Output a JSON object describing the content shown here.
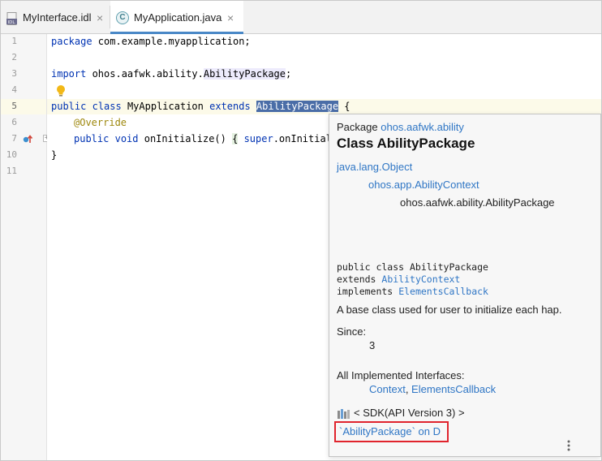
{
  "tabs": [
    {
      "label": "MyInterface.idl",
      "icon": "idl-file-icon",
      "active": false
    },
    {
      "label": "MyApplication.java",
      "icon": "java-class-icon",
      "active": true
    }
  ],
  "line_numbers": [
    "1",
    "2",
    "3",
    "4",
    "5",
    "6",
    "7",
    "10",
    "11"
  ],
  "code": {
    "line1_kw": "package",
    "line1_rest": " com.example.myapplication;",
    "line3_kw": "import",
    "line3_mid": " ohos.aafwk.ability.",
    "line3_cls": "AbilityPackage",
    "line3_end": ";",
    "line5_kw1": "public",
    "line5_kw2": "class",
    "line5_name": " MyApplication ",
    "line5_kw3": "extends",
    "line5_sel": "AbilityPackage",
    "line5_end": " {",
    "line6_ann": "@Override",
    "line7_kw1": "public",
    "line7_kw2": "void",
    "line7_rest": " onInitialize() ",
    "line7_brace": "{",
    "line7_kw3": "super",
    "line7_tail": ".onInitiali",
    "line10": "}"
  },
  "popup": {
    "package_label": "Package",
    "package_name": "ohos.aafwk.ability",
    "class_title": "Class AbilityPackage",
    "hierarchy": [
      "java.lang.Object",
      "ohos.app.AbilityContext",
      "ohos.aafwk.ability.AbilityPackage"
    ],
    "decl_line1": "public class AbilityPackage",
    "decl_extends_kw": "extends",
    "decl_extends": "AbilityContext",
    "decl_impl_kw": "implements",
    "decl_impl": "ElementsCallback",
    "description": "A base class used for user to initialize each hap.",
    "since_label": "Since:",
    "since_value": "3",
    "interfaces_label": "All Implemented Interfaces:",
    "interface_1": "Context",
    "interface_sep": ", ",
    "interface_2": "ElementsCallback",
    "sdk_label": "< SDK(API Version 3) >",
    "external_link": "`AbilityPackage` on D"
  },
  "colors": {
    "keyword": "#0033b3",
    "annotation": "#9e880d",
    "link": "#2f76c5",
    "selection": "#4a6da7",
    "current_line": "#fcfae9",
    "highlight_box": "#e0242d"
  }
}
